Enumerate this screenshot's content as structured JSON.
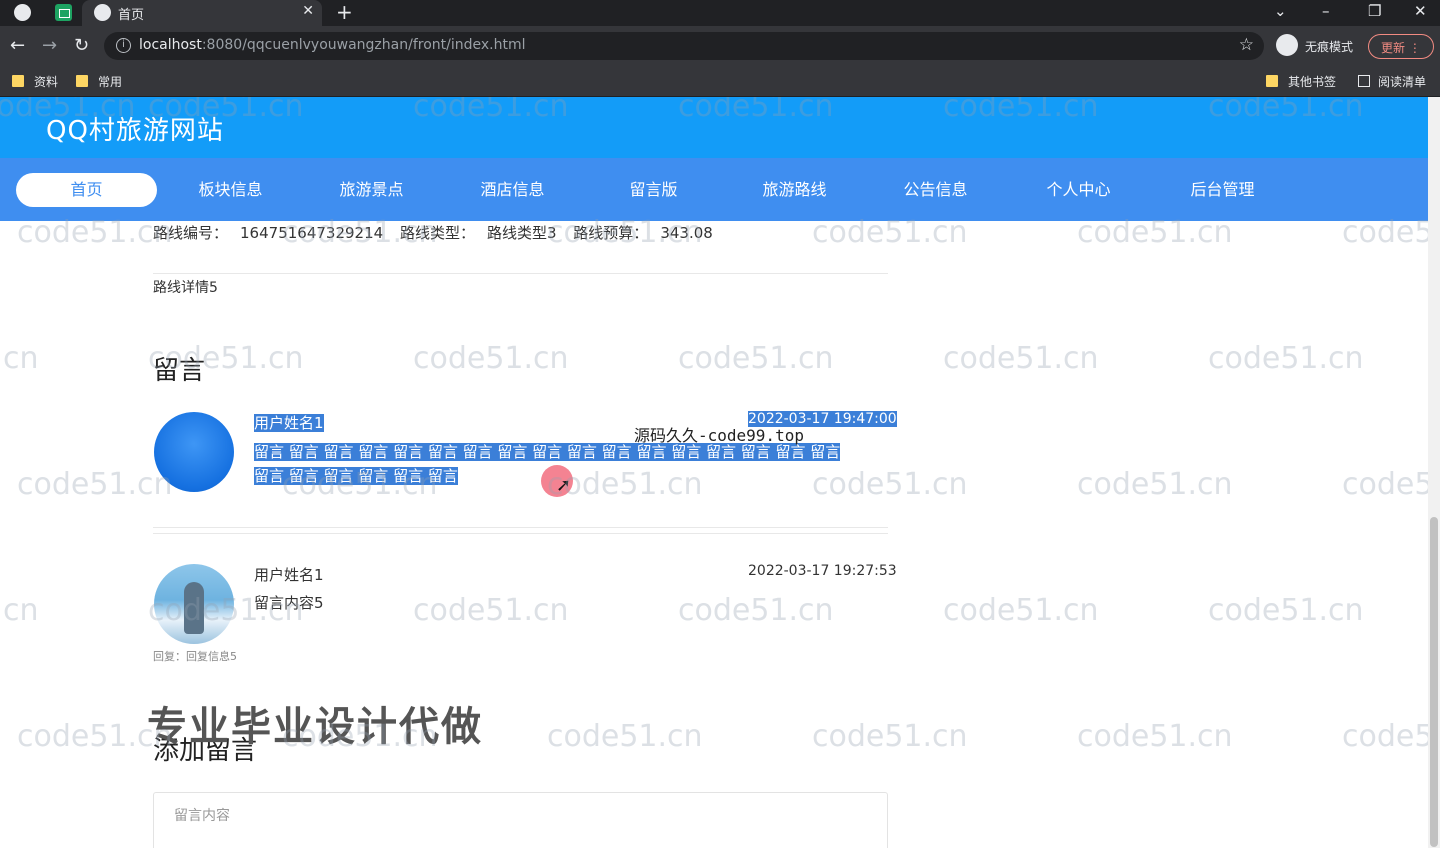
{
  "browser": {
    "tab_title": "首页",
    "new_tab": "+",
    "close": "✕",
    "url_host": "localhost",
    "url_rest": ":8080/qqcuenlvyouwangzhan/front/index.html",
    "incognito_label": "无痕模式",
    "update_label": "更新",
    "bookmarks": [
      "资料",
      "常用"
    ],
    "other_bookmarks": "其他书签",
    "reading_list": "阅读清单"
  },
  "site": {
    "title": "QQ村旅游网站",
    "nav": [
      "首页",
      "板块信息",
      "旅游景点",
      "酒店信息",
      "留言版",
      "旅游路线",
      "公告信息",
      "个人中心",
      "后台管理"
    ]
  },
  "route": {
    "number_label": "路线编号：",
    "number": "164751647329214",
    "type_label": "路线类型：",
    "type": "路线类型3",
    "budget_label": "路线预算：",
    "budget": "343.08",
    "detail": "路线详情5"
  },
  "comments": {
    "section_title": "留言",
    "items": [
      {
        "user": "用户姓名1",
        "time": "2022-03-17 19:47:00",
        "line1": "留言 留言 留言 留言 留言 留言 留言 留言 留言 留言 留言 留言 留言 留言 留言 留言 留言",
        "line2": "留言 留言 留言 留言 留言 留言"
      },
      {
        "user": "用户姓名1",
        "time": "2022-03-17 19:27:53",
        "content": "留言内容5",
        "reply": "回复：回复信息5"
      }
    ]
  },
  "add_comment": {
    "title": "添加留言",
    "placeholder": "留言内容"
  },
  "overlay": {
    "source_text": "源码久久-code99.top",
    "promo": "专业毕业设计代做",
    "watermark": "code51.cn"
  }
}
